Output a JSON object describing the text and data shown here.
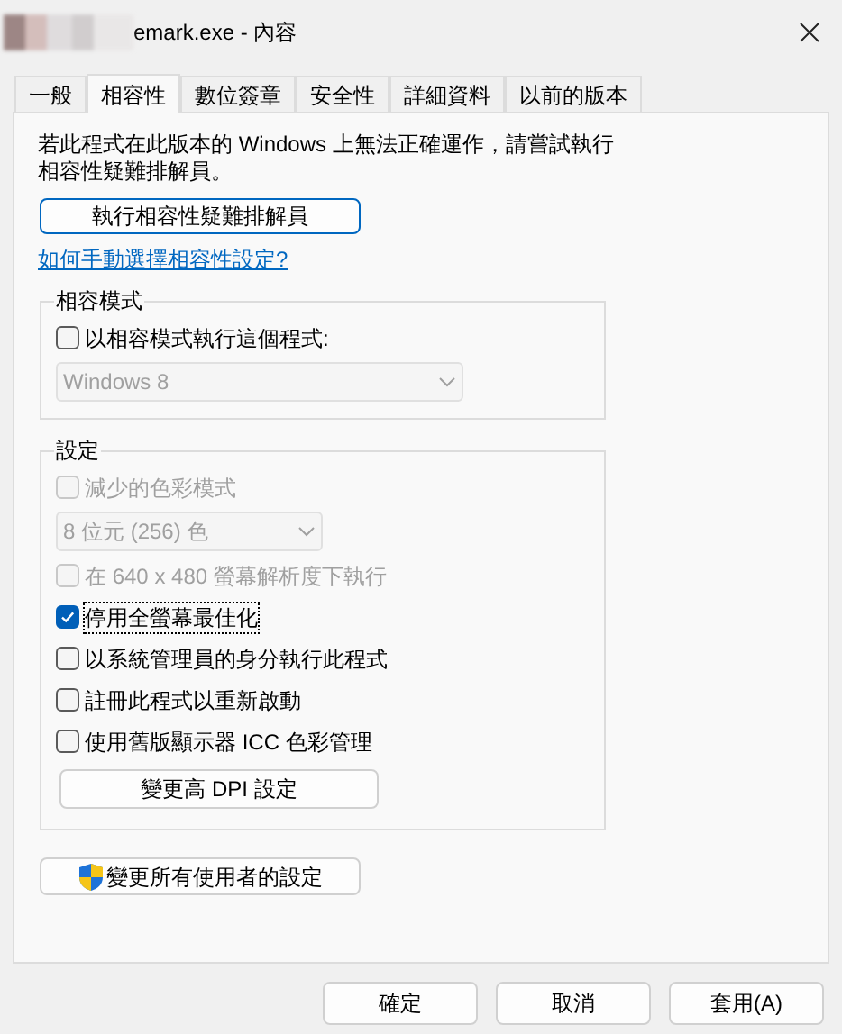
{
  "window": {
    "title": "emark.exe - 內容"
  },
  "tabs": [
    {
      "label": "一般",
      "selected": false
    },
    {
      "label": "相容性",
      "selected": true
    },
    {
      "label": "數位簽章",
      "selected": false
    },
    {
      "label": "安全性",
      "selected": false
    },
    {
      "label": "詳細資料",
      "selected": false
    },
    {
      "label": "以前的版本",
      "selected": false
    }
  ],
  "intro": "若此程式在此版本的 Windows 上無法正確運作，請嘗試執行相容性疑難排解員。",
  "troubleshooter_button": "執行相容性疑難排解員",
  "help_link": "如何手動選擇相容性設定?",
  "compat_group": {
    "title": "相容模式",
    "items": [
      {
        "kind": "checkbox",
        "label": "以相容模式執行這個程式:",
        "checked": false,
        "disabled": false,
        "focused": false
      },
      {
        "kind": "dropdown",
        "value": "Windows 8",
        "disabled": true
      }
    ]
  },
  "settings_group": {
    "title": "設定",
    "items": [
      {
        "kind": "checkbox",
        "label": "減少的色彩模式",
        "checked": false,
        "disabled": true,
        "focused": false
      },
      {
        "kind": "dropdown",
        "value": "8 位元 (256) 色",
        "disabled": true
      },
      {
        "kind": "checkbox",
        "label": "在 640 x 480 螢幕解析度下執行",
        "checked": false,
        "disabled": true,
        "focused": false
      },
      {
        "kind": "checkbox",
        "label": "停用全螢幕最佳化",
        "checked": true,
        "disabled": false,
        "focused": true
      },
      {
        "kind": "checkbox",
        "label": "以系統管理員的身分執行此程式",
        "checked": false,
        "disabled": false,
        "focused": false
      },
      {
        "kind": "checkbox",
        "label": "註冊此程式以重新啟動",
        "checked": false,
        "disabled": false,
        "focused": false
      },
      {
        "kind": "checkbox",
        "label": "使用舊版顯示器 ICC 色彩管理",
        "checked": false,
        "disabled": false,
        "focused": false
      },
      {
        "kind": "button",
        "label": "變更高 DPI 設定"
      }
    ]
  },
  "all_users_button": "變更所有使用者的設定",
  "buttons": [
    "確定",
    "取消",
    "套用(A)"
  ]
}
